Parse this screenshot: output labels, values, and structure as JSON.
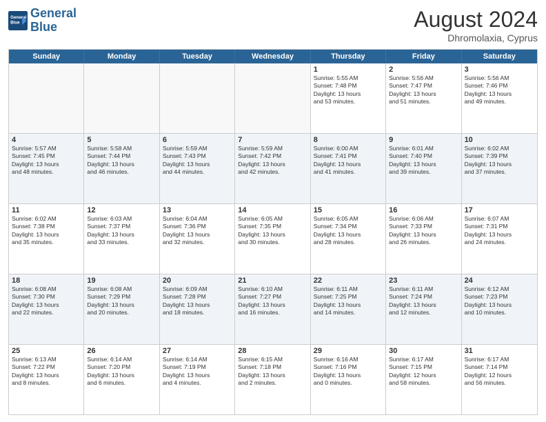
{
  "logo": {
    "line1": "General",
    "line2": "Blue"
  },
  "title": "August 2024",
  "subtitle": "Dhromolaxia, Cyprus",
  "header_days": [
    "Sunday",
    "Monday",
    "Tuesday",
    "Wednesday",
    "Thursday",
    "Friday",
    "Saturday"
  ],
  "rows": [
    [
      {
        "day": "",
        "info": "",
        "empty": true
      },
      {
        "day": "",
        "info": "",
        "empty": true
      },
      {
        "day": "",
        "info": "",
        "empty": true
      },
      {
        "day": "",
        "info": "",
        "empty": true
      },
      {
        "day": "1",
        "info": "Sunrise: 5:55 AM\nSunset: 7:48 PM\nDaylight: 13 hours\nand 53 minutes."
      },
      {
        "day": "2",
        "info": "Sunrise: 5:56 AM\nSunset: 7:47 PM\nDaylight: 13 hours\nand 51 minutes."
      },
      {
        "day": "3",
        "info": "Sunrise: 5:56 AM\nSunset: 7:46 PM\nDaylight: 13 hours\nand 49 minutes."
      }
    ],
    [
      {
        "day": "4",
        "info": "Sunrise: 5:57 AM\nSunset: 7:45 PM\nDaylight: 13 hours\nand 48 minutes.",
        "alt": true
      },
      {
        "day": "5",
        "info": "Sunrise: 5:58 AM\nSunset: 7:44 PM\nDaylight: 13 hours\nand 46 minutes.",
        "alt": true
      },
      {
        "day": "6",
        "info": "Sunrise: 5:59 AM\nSunset: 7:43 PM\nDaylight: 13 hours\nand 44 minutes.",
        "alt": true
      },
      {
        "day": "7",
        "info": "Sunrise: 5:59 AM\nSunset: 7:42 PM\nDaylight: 13 hours\nand 42 minutes.",
        "alt": true
      },
      {
        "day": "8",
        "info": "Sunrise: 6:00 AM\nSunset: 7:41 PM\nDaylight: 13 hours\nand 41 minutes.",
        "alt": true
      },
      {
        "day": "9",
        "info": "Sunrise: 6:01 AM\nSunset: 7:40 PM\nDaylight: 13 hours\nand 39 minutes.",
        "alt": true
      },
      {
        "day": "10",
        "info": "Sunrise: 6:02 AM\nSunset: 7:39 PM\nDaylight: 13 hours\nand 37 minutes.",
        "alt": true
      }
    ],
    [
      {
        "day": "11",
        "info": "Sunrise: 6:02 AM\nSunset: 7:38 PM\nDaylight: 13 hours\nand 35 minutes."
      },
      {
        "day": "12",
        "info": "Sunrise: 6:03 AM\nSunset: 7:37 PM\nDaylight: 13 hours\nand 33 minutes."
      },
      {
        "day": "13",
        "info": "Sunrise: 6:04 AM\nSunset: 7:36 PM\nDaylight: 13 hours\nand 32 minutes."
      },
      {
        "day": "14",
        "info": "Sunrise: 6:05 AM\nSunset: 7:35 PM\nDaylight: 13 hours\nand 30 minutes."
      },
      {
        "day": "15",
        "info": "Sunrise: 6:05 AM\nSunset: 7:34 PM\nDaylight: 13 hours\nand 28 minutes."
      },
      {
        "day": "16",
        "info": "Sunrise: 6:06 AM\nSunset: 7:33 PM\nDaylight: 13 hours\nand 26 minutes."
      },
      {
        "day": "17",
        "info": "Sunrise: 6:07 AM\nSunset: 7:31 PM\nDaylight: 13 hours\nand 24 minutes."
      }
    ],
    [
      {
        "day": "18",
        "info": "Sunrise: 6:08 AM\nSunset: 7:30 PM\nDaylight: 13 hours\nand 22 minutes.",
        "alt": true
      },
      {
        "day": "19",
        "info": "Sunrise: 6:08 AM\nSunset: 7:29 PM\nDaylight: 13 hours\nand 20 minutes.",
        "alt": true
      },
      {
        "day": "20",
        "info": "Sunrise: 6:09 AM\nSunset: 7:28 PM\nDaylight: 13 hours\nand 18 minutes.",
        "alt": true
      },
      {
        "day": "21",
        "info": "Sunrise: 6:10 AM\nSunset: 7:27 PM\nDaylight: 13 hours\nand 16 minutes.",
        "alt": true
      },
      {
        "day": "22",
        "info": "Sunrise: 6:11 AM\nSunset: 7:25 PM\nDaylight: 13 hours\nand 14 minutes.",
        "alt": true
      },
      {
        "day": "23",
        "info": "Sunrise: 6:11 AM\nSunset: 7:24 PM\nDaylight: 13 hours\nand 12 minutes.",
        "alt": true
      },
      {
        "day": "24",
        "info": "Sunrise: 6:12 AM\nSunset: 7:23 PM\nDaylight: 13 hours\nand 10 minutes.",
        "alt": true
      }
    ],
    [
      {
        "day": "25",
        "info": "Sunrise: 6:13 AM\nSunset: 7:22 PM\nDaylight: 13 hours\nand 8 minutes."
      },
      {
        "day": "26",
        "info": "Sunrise: 6:14 AM\nSunset: 7:20 PM\nDaylight: 13 hours\nand 6 minutes."
      },
      {
        "day": "27",
        "info": "Sunrise: 6:14 AM\nSunset: 7:19 PM\nDaylight: 13 hours\nand 4 minutes."
      },
      {
        "day": "28",
        "info": "Sunrise: 6:15 AM\nSunset: 7:18 PM\nDaylight: 13 hours\nand 2 minutes."
      },
      {
        "day": "29",
        "info": "Sunrise: 6:16 AM\nSunset: 7:16 PM\nDaylight: 13 hours\nand 0 minutes."
      },
      {
        "day": "30",
        "info": "Sunrise: 6:17 AM\nSunset: 7:15 PM\nDaylight: 12 hours\nand 58 minutes."
      },
      {
        "day": "31",
        "info": "Sunrise: 6:17 AM\nSunset: 7:14 PM\nDaylight: 12 hours\nand 56 minutes."
      }
    ]
  ]
}
